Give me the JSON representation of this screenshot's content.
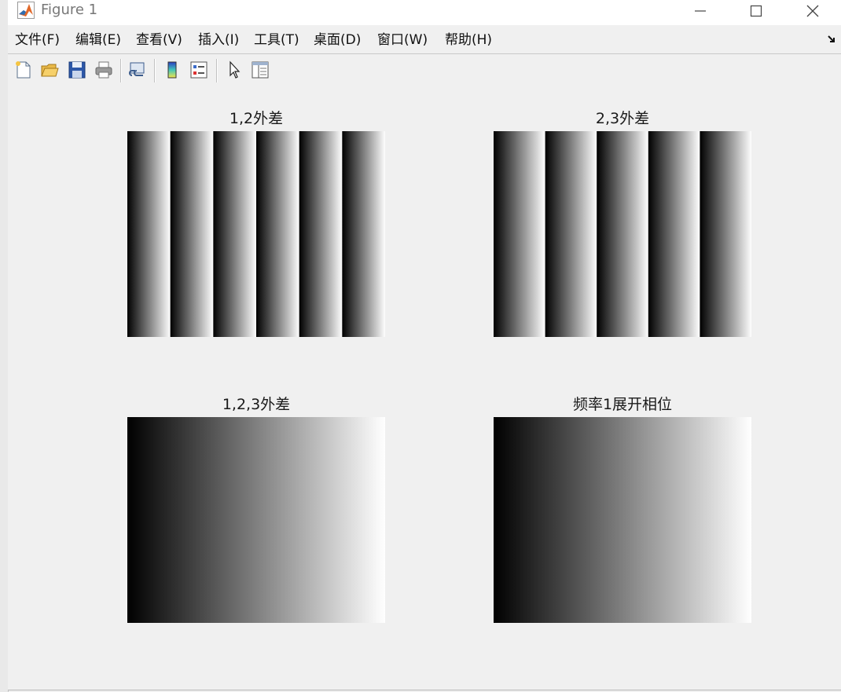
{
  "window": {
    "title": "Figure 1"
  },
  "menu": [
    "文件(F)",
    "编辑(E)",
    "查看(V)",
    "插入(I)",
    "工具(T)",
    "桌面(D)",
    "窗口(W)",
    "帮助(H)"
  ],
  "toolbar": {
    "buttons": [
      "new-figure-icon",
      "open-file-icon",
      "save-icon",
      "print-icon",
      "link-plot-icon",
      "colorbar-icon",
      "legend-icon",
      "pointer-icon",
      "property-editor-icon"
    ]
  },
  "plots": [
    {
      "title": "1,2外差",
      "kind": "stripes",
      "stripes": 6
    },
    {
      "title": "2,3外差",
      "kind": "stripes",
      "stripes": 5
    },
    {
      "title": "1,2,3外差",
      "kind": "gradient"
    },
    {
      "title": "频率1展开相位",
      "kind": "gradient"
    }
  ],
  "colors": {
    "background": "#f0f0f0",
    "titlebar": "#ffffff",
    "toolbar_border": "#c9c9c9"
  }
}
